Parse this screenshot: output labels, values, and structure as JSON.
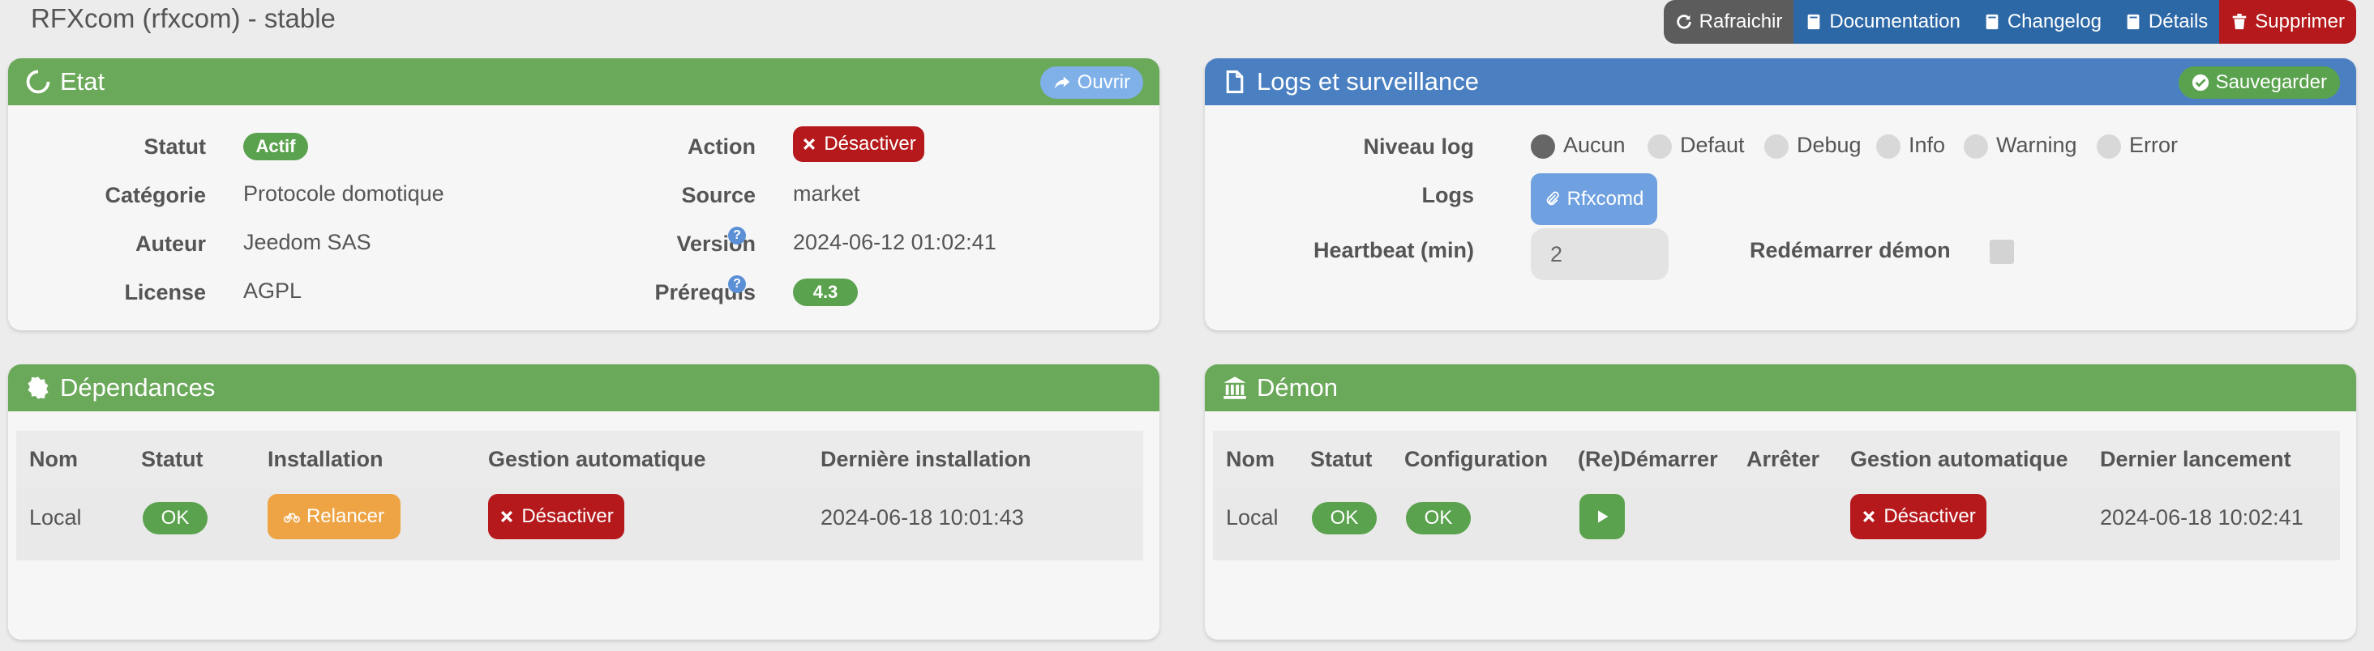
{
  "page_title": "RFXcom (rfxcom) - stable",
  "toolbar": {
    "refresh": "Rafraichir",
    "documentation": "Documentation",
    "changelog": "Changelog",
    "details": "Détails",
    "delete": "Supprimer"
  },
  "etat": {
    "title": "Etat",
    "open_button": "Ouvrir",
    "statut_label": "Statut",
    "statut_value": "Actif",
    "categorie_label": "Catégorie",
    "categorie_value": "Protocole domotique",
    "auteur_label": "Auteur",
    "auteur_value": "Jeedom SAS",
    "license_label": "License",
    "license_value": "AGPL",
    "action_label": "Action",
    "action_button": "Désactiver",
    "source_label": "Source",
    "source_value": "market",
    "version_label": "Version",
    "version_value": "2024-06-12 01:02:41",
    "prerequis_label": "Prérequis",
    "prerequis_value": "4.3"
  },
  "logs": {
    "title": "Logs et surveillance",
    "save_button": "Sauvegarder",
    "niveau_label": "Niveau log",
    "levels": [
      "Aucun",
      "Defaut",
      "Debug",
      "Info",
      "Warning",
      "Error"
    ],
    "selected_level": "Aucun",
    "logs_label": "Logs",
    "logs_button": "Rfxcomd",
    "heartbeat_label": "Heartbeat (min)",
    "heartbeat_value": "2",
    "restart_label": "Redémarrer démon"
  },
  "dependances": {
    "title": "Dépendances",
    "headers": [
      "Nom",
      "Statut",
      "Installation",
      "Gestion automatique",
      "Dernière installation"
    ],
    "row": {
      "nom": "Local",
      "statut": "OK",
      "installation": "Relancer",
      "gestion": "Désactiver",
      "derniere": "2024-06-18 10:01:43"
    }
  },
  "demon": {
    "title": "Démon",
    "headers": [
      "Nom",
      "Statut",
      "Configuration",
      "(Re)Démarrer",
      "Arrêter",
      "Gestion automatique",
      "Dernier lancement"
    ],
    "row": {
      "nom": "Local",
      "statut": "OK",
      "configuration": "OK",
      "gestion": "Désactiver",
      "dernier": "2024-06-18 10:02:41"
    }
  }
}
